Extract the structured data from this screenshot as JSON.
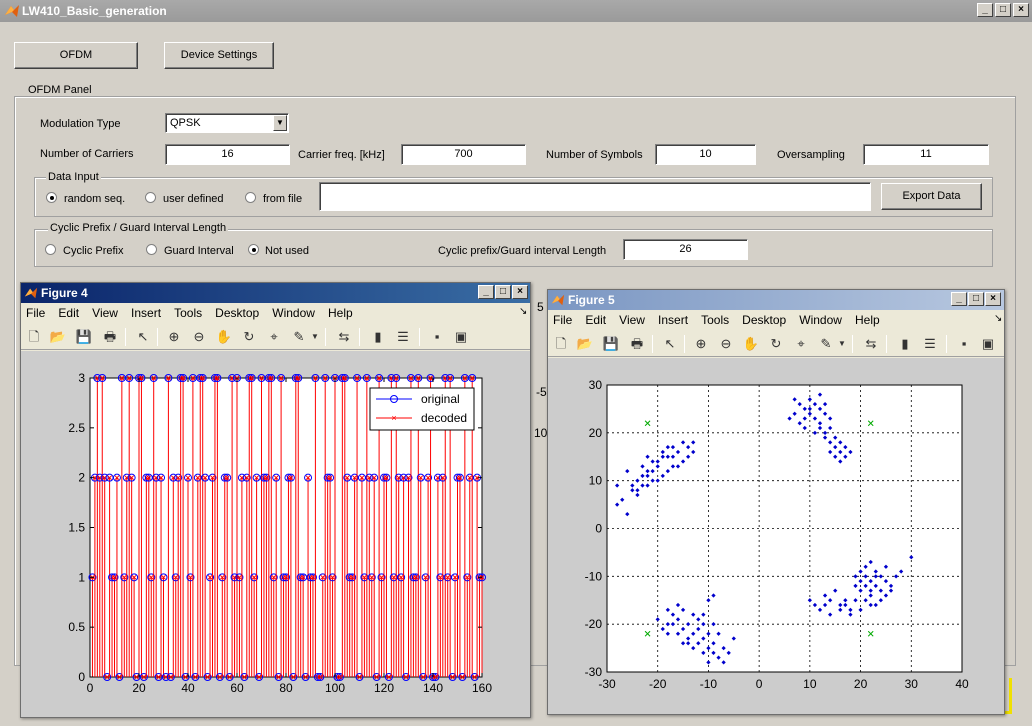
{
  "app": {
    "title": "LW410_Basic_generation",
    "buttons": {
      "ofdm": "OFDM",
      "device_settings": "Device Settings"
    }
  },
  "ofdm_panel": {
    "title": "OFDM Panel",
    "modulation_label": "Modulation Type",
    "modulation_value": "QPSK",
    "carriers_label": "Number of Carriers",
    "carriers_value": "16",
    "carrier_freq_label": "Carrier freq. [kHz]",
    "carrier_freq_value": "700",
    "symbols_label": "Number of Symbols",
    "symbols_value": "10",
    "oversampling_label": "Oversampling",
    "oversampling_value": "11",
    "data_input": {
      "title": "Data Input",
      "random_label": "random seq.",
      "user_defined_label": "user defined",
      "from_file_label": "from file",
      "file_value": "",
      "export_label": "Export Data",
      "selected": "random"
    },
    "cyclic": {
      "title": "Cyclic Prefix / Guard Interval Length",
      "cp_label": "Cyclic Prefix",
      "gi_label": "Guard Interval",
      "none_label": "Not used",
      "length_label": "Cyclic prefix/Guard interval Length",
      "length_value": "26",
      "selected": "none"
    }
  },
  "background_fragments": [
    "5",
    "-5",
    "10"
  ],
  "figure_menu": [
    "File",
    "Edit",
    "View",
    "Insert",
    "Tools",
    "Desktop",
    "Window",
    "Help"
  ],
  "figure4": {
    "title": "Figure 4",
    "active": true,
    "colors": {
      "original": "#0000ff",
      "decoded": "#ff0000"
    },
    "chart_data": {
      "type": "stem",
      "xlim": [
        0,
        160
      ],
      "ylim": [
        0,
        3
      ],
      "xticks": [
        0,
        20,
        40,
        60,
        80,
        100,
        120,
        140,
        160
      ],
      "yticks": [
        0,
        0.5,
        1,
        1.5,
        2,
        2.5,
        3
      ],
      "xtick_labels": [
        "0",
        "20",
        "40",
        "60",
        "80",
        "100",
        "120",
        "140",
        "160"
      ],
      "ytick_labels": [
        "0",
        "0.5",
        "1",
        "1.5",
        "2",
        "2.5",
        "3"
      ],
      "legend": [
        "original",
        "decoded"
      ],
      "legend_position": "top-right",
      "grid": false,
      "x_start": 1,
      "values": [
        1,
        2,
        3,
        2,
        3,
        2,
        0,
        2,
        1,
        1,
        2,
        0,
        3,
        1,
        2,
        3,
        2,
        1,
        0,
        3,
        3,
        0,
        2,
        2,
        1,
        3,
        2,
        0,
        2,
        1,
        0,
        3,
        0,
        2,
        1,
        2,
        3,
        3,
        0,
        2,
        1,
        3,
        0,
        2,
        3,
        3,
        2,
        0,
        1,
        2,
        3,
        3,
        0,
        1,
        2,
        2,
        0,
        3,
        1,
        3,
        1,
        2,
        0,
        2,
        3,
        3,
        1,
        2,
        0,
        3,
        2,
        2,
        3,
        3,
        1,
        2,
        0,
        3,
        1,
        1,
        2,
        2,
        0,
        3,
        3,
        1,
        1,
        0,
        2,
        1,
        1,
        3,
        0,
        0,
        1,
        3,
        2,
        2,
        1,
        3,
        0,
        0,
        3,
        3,
        2,
        1,
        1,
        2,
        3,
        0,
        2,
        1,
        3,
        2,
        1,
        2,
        0,
        3,
        1,
        2,
        2,
        0,
        3,
        1,
        3,
        2,
        1,
        2,
        0,
        2,
        3,
        1,
        1,
        3,
        2,
        0,
        1,
        2,
        3,
        0,
        0,
        2,
        1,
        2,
        3,
        1,
        3,
        0,
        1,
        2,
        2,
        0,
        3,
        1,
        2,
        3,
        0,
        2,
        1,
        1
      ]
    }
  },
  "figure5": {
    "title": "Figure 5",
    "active": false,
    "colors": {
      "received": "#0000cc",
      "ideal": "#00aa00"
    },
    "chart_data": {
      "type": "scatter",
      "xlim": [
        -30,
        40
      ],
      "ylim": [
        -30,
        30
      ],
      "xticks": [
        -30,
        -20,
        -10,
        0,
        10,
        20,
        30,
        40
      ],
      "yticks": [
        -30,
        -20,
        -10,
        0,
        10,
        20,
        30
      ],
      "xtick_labels": [
        "-30",
        "-20",
        "-10",
        "0",
        "10",
        "20",
        "30",
        "40"
      ],
      "ytick_labels": [
        "-30",
        "-20",
        "-10",
        "0",
        "10",
        "20",
        "30"
      ],
      "grid": true,
      "ideal_points": [
        [
          -22,
          22
        ],
        [
          22,
          22
        ],
        [
          -22,
          -22
        ],
        [
          22,
          -22
        ]
      ],
      "received_points": [
        [
          -28,
          9
        ],
        [
          -27,
          6
        ],
        [
          -28,
          5
        ],
        [
          -26,
          12
        ],
        [
          -25,
          9
        ],
        [
          -24,
          10
        ],
        [
          -25,
          8
        ],
        [
          -23,
          11
        ],
        [
          -22,
          12
        ],
        [
          -21,
          14
        ],
        [
          -23,
          13
        ],
        [
          -22,
          15
        ],
        [
          -20,
          14
        ],
        [
          -19,
          16
        ],
        [
          -18,
          15
        ],
        [
          -17,
          17
        ],
        [
          -16,
          16
        ],
        [
          -15,
          18
        ],
        [
          -14,
          17
        ],
        [
          -13,
          18
        ],
        [
          -15,
          14
        ],
        [
          -14,
          15
        ],
        [
          -17,
          13
        ],
        [
          -18,
          12
        ],
        [
          -19,
          11
        ],
        [
          -20,
          10
        ],
        [
          -21,
          10
        ],
        [
          -22,
          9
        ],
        [
          -24,
          7
        ],
        [
          -26,
          3
        ],
        [
          -24,
          8
        ],
        [
          -22,
          11
        ],
        [
          -20,
          13
        ],
        [
          -18,
          17
        ],
        [
          -16,
          13
        ],
        [
          -13,
          16
        ],
        [
          -21,
          12
        ],
        [
          -23,
          9
        ],
        [
          -19,
          15
        ],
        [
          -17,
          15
        ],
        [
          7,
          27
        ],
        [
          8,
          26
        ],
        [
          9,
          25
        ],
        [
          10,
          27
        ],
        [
          11,
          26
        ],
        [
          12,
          25
        ],
        [
          13,
          24
        ],
        [
          14,
          23
        ],
        [
          12,
          22
        ],
        [
          10,
          24
        ],
        [
          8,
          22
        ],
        [
          9,
          23
        ],
        [
          11,
          23
        ],
        [
          12,
          21
        ],
        [
          13,
          20
        ],
        [
          14,
          18
        ],
        [
          15,
          17
        ],
        [
          16,
          16
        ],
        [
          15,
          15
        ],
        [
          17,
          17
        ],
        [
          18,
          16
        ],
        [
          16,
          18
        ],
        [
          14,
          21
        ],
        [
          13,
          19
        ],
        [
          15,
          19
        ],
        [
          11,
          20
        ],
        [
          9,
          21
        ],
        [
          7,
          24
        ],
        [
          6,
          23
        ],
        [
          12,
          28
        ],
        [
          10,
          25
        ],
        [
          13,
          26
        ],
        [
          16,
          14
        ],
        [
          17,
          15
        ],
        [
          14,
          16
        ],
        [
          -18,
          -22
        ],
        [
          -17,
          -20
        ],
        [
          -16,
          -19
        ],
        [
          -15,
          -21
        ],
        [
          -14,
          -20
        ],
        [
          -13,
          -22
        ],
        [
          -12,
          -21
        ],
        [
          -11,
          -23
        ],
        [
          -10,
          -22
        ],
        [
          -9,
          -24
        ],
        [
          -10,
          -25
        ],
        [
          -11,
          -26
        ],
        [
          -12,
          -24
        ],
        [
          -13,
          -25
        ],
        [
          -14,
          -23
        ],
        [
          -15,
          -24
        ],
        [
          -16,
          -22
        ],
        [
          -17,
          -18
        ],
        [
          -15,
          -17
        ],
        [
          -16,
          -16
        ],
        [
          -18,
          -20
        ],
        [
          -19,
          -21
        ],
        [
          -9,
          -20
        ],
        [
          -8,
          -22
        ],
        [
          -7,
          -25
        ],
        [
          -8,
          -27
        ],
        [
          -9,
          -26
        ],
        [
          -10,
          -28
        ],
        [
          -5,
          -23
        ],
        [
          -7,
          -28
        ],
        [
          -12,
          -19
        ],
        [
          -11,
          -18
        ],
        [
          -13,
          -18
        ],
        [
          -10,
          -15
        ],
        [
          -9,
          -14
        ],
        [
          -20,
          -19
        ],
        [
          -18,
          -17
        ],
        [
          -6,
          -26
        ],
        [
          -11,
          -20
        ],
        [
          -14,
          -24
        ],
        [
          10,
          -15
        ],
        [
          11,
          -16
        ],
        [
          12,
          -17
        ],
        [
          13,
          -14
        ],
        [
          14,
          -15
        ],
        [
          15,
          -13
        ],
        [
          16,
          -16
        ],
        [
          17,
          -15
        ],
        [
          18,
          -17
        ],
        [
          19,
          -15
        ],
        [
          20,
          -13
        ],
        [
          21,
          -12
        ],
        [
          22,
          -14
        ],
        [
          23,
          -12
        ],
        [
          24,
          -13
        ],
        [
          25,
          -11
        ],
        [
          24,
          -10
        ],
        [
          23,
          -9
        ],
        [
          22,
          -11
        ],
        [
          21,
          -10
        ],
        [
          20,
          -9
        ],
        [
          19,
          -10
        ],
        [
          21,
          -8
        ],
        [
          22,
          -7
        ],
        [
          23,
          -10
        ],
        [
          25,
          -14
        ],
        [
          26,
          -12
        ],
        [
          27,
          -10
        ],
        [
          28,
          -9
        ],
        [
          30,
          -6
        ],
        [
          24,
          -15
        ],
        [
          22,
          -16
        ],
        [
          20,
          -17
        ],
        [
          18,
          -18
        ],
        [
          17,
          -16
        ],
        [
          19,
          -12
        ],
        [
          20,
          -11
        ],
        [
          16,
          -17
        ],
        [
          14,
          -18
        ],
        [
          13,
          -16
        ],
        [
          21,
          -15
        ],
        [
          23,
          -16
        ],
        [
          26,
          -13
        ],
        [
          25,
          -8
        ],
        [
          22,
          -13
        ]
      ]
    }
  }
}
